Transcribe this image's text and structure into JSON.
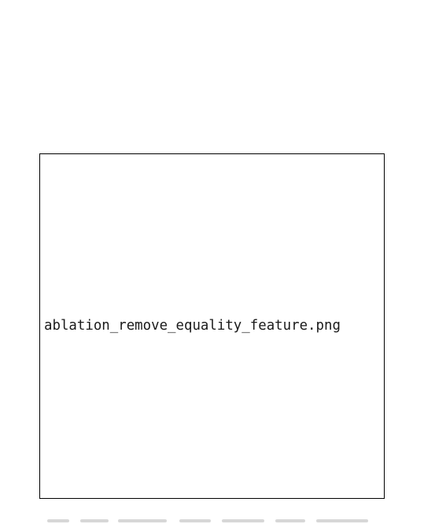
{
  "figure": {
    "placeholder_filename": "ablation_remove_equality_feature.png"
  }
}
